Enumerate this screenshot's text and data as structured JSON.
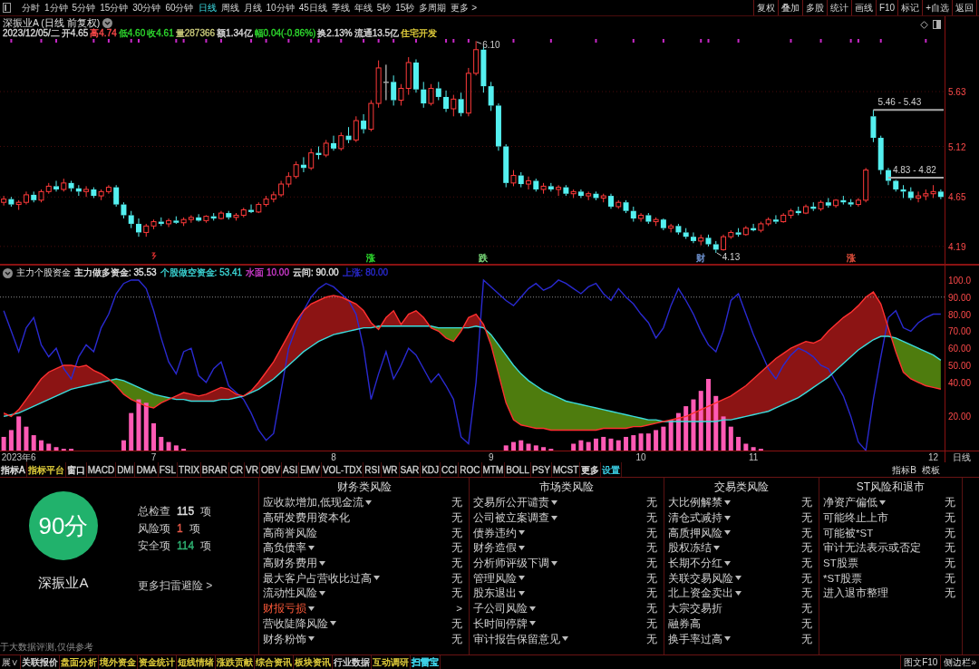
{
  "toolbar": {
    "periods": [
      {
        "label": "分时",
        "selected": false
      },
      {
        "label": "1分钟",
        "selected": false
      },
      {
        "label": "5分钟",
        "selected": false
      },
      {
        "label": "15分钟",
        "selected": false
      },
      {
        "label": "30分钟",
        "selected": false
      },
      {
        "label": "60分钟",
        "selected": false
      },
      {
        "label": "日线",
        "selected": true
      },
      {
        "label": "周线",
        "selected": false
      },
      {
        "label": "月线",
        "selected": false
      },
      {
        "label": "10分钟",
        "selected": false
      },
      {
        "label": "45日线",
        "selected": false
      },
      {
        "label": "季线",
        "selected": false
      },
      {
        "label": "年线",
        "selected": false
      },
      {
        "label": "5秒",
        "selected": false
      },
      {
        "label": "15秒",
        "selected": false
      },
      {
        "label": "多周期",
        "selected": false
      },
      {
        "label": "更多 >",
        "selected": false
      }
    ],
    "actions": [
      "复权",
      "叠加",
      "多股",
      "统计",
      "画线",
      "F10",
      "标记",
      "+自选",
      "返回"
    ]
  },
  "price_chart": {
    "title": "深振业A (日线 前复权)",
    "quote": [
      {
        "text": "2023/12/05/二",
        "color": "#dcdcdc"
      },
      {
        "text": "开4.65",
        "color": "#dcdcdc"
      },
      {
        "text": "高4.74",
        "color": "#ff4a4a"
      },
      {
        "text": "低4.60",
        "color": "#2ed82e"
      },
      {
        "text": "收4.61",
        "color": "#2ed82e"
      },
      {
        "text": "量287366",
        "color": "#c8c87a"
      },
      {
        "text": "额1.34亿",
        "color": "#dcdcdc"
      },
      {
        "text": "幅0.04(-0.86%)",
        "color": "#2ed82e"
      },
      {
        "text": "换2.13%",
        "color": "#dcdcdc"
      },
      {
        "text": "流通13.5亿",
        "color": "#dcdcdc"
      },
      {
        "text": "住宅开发",
        "color": "#e6d23c"
      }
    ],
    "event_tags": [
      {
        "color": "#2ed82e"
      },
      {
        "color": "#7ad87a"
      },
      {
        "color": "#6a8cc8"
      },
      {
        "color": "#e0503c"
      }
    ],
    "chart_data": {
      "type": "candlestick",
      "ylim": [
        4.02,
        6.33
      ],
      "yticks": [
        5.63,
        5.12,
        4.65,
        4.19
      ],
      "grid": true,
      "categories": [
        null,
        null,
        null,
        null,
        null,
        null,
        null,
        null,
        null,
        null,
        null,
        null,
        null,
        null,
        null,
        null,
        null,
        null,
        null,
        null,
        null,
        null,
        null,
        null,
        null,
        null,
        null,
        null,
        null,
        null,
        null,
        null,
        null,
        null,
        null,
        null,
        null,
        null,
        null,
        null,
        null,
        null,
        null,
        null,
        null,
        null,
        null,
        null,
        null,
        "涨",
        null,
        null,
        null,
        null,
        null,
        null,
        null,
        null,
        null,
        null,
        null,
        null,
        null,
        null,
        "跌",
        null,
        null,
        null,
        null,
        null,
        null,
        null,
        null,
        null,
        null,
        null,
        null,
        null,
        null,
        null,
        null,
        null,
        null,
        null,
        null,
        null,
        null,
        null,
        null,
        null,
        null,
        null,
        null,
        "财",
        null,
        null,
        null,
        null,
        null,
        null,
        null,
        null,
        null,
        null,
        null,
        null,
        null,
        null,
        null,
        null,
        null,
        null,
        null,
        "涨",
        null,
        null,
        null,
        null,
        null,
        null,
        null,
        null,
        null,
        null,
        null,
        null
      ],
      "ohlc": [
        [
          4.6,
          4.66,
          4.57,
          4.63
        ],
        [
          4.63,
          4.65,
          4.56,
          4.58
        ],
        [
          4.58,
          4.62,
          4.53,
          4.6
        ],
        [
          4.6,
          4.7,
          4.58,
          4.67
        ],
        [
          4.67,
          4.7,
          4.6,
          4.62
        ],
        [
          4.62,
          4.72,
          4.6,
          4.7
        ],
        [
          4.7,
          4.78,
          4.68,
          4.75
        ],
        [
          4.75,
          4.8,
          4.7,
          4.72
        ],
        [
          4.72,
          4.82,
          4.7,
          4.78
        ],
        [
          4.78,
          4.8,
          4.7,
          4.73
        ],
        [
          4.73,
          4.76,
          4.66,
          4.7
        ],
        [
          4.7,
          4.75,
          4.65,
          4.72
        ],
        [
          4.72,
          4.74,
          4.64,
          4.66
        ],
        [
          4.66,
          4.72,
          4.62,
          4.7
        ],
        [
          4.7,
          4.76,
          4.68,
          4.74
        ],
        [
          4.74,
          4.76,
          4.56,
          4.58
        ],
        [
          4.58,
          4.6,
          4.45,
          4.48
        ],
        [
          4.48,
          4.52,
          4.36,
          4.4
        ],
        [
          4.4,
          4.45,
          4.28,
          4.32
        ],
        [
          4.32,
          4.4,
          4.28,
          4.38
        ],
        [
          4.38,
          4.44,
          4.35,
          4.42
        ],
        [
          4.42,
          4.46,
          4.38,
          4.4
        ],
        [
          4.4,
          4.45,
          4.37,
          4.43
        ],
        [
          4.43,
          4.47,
          4.4,
          4.41
        ],
        [
          4.41,
          4.46,
          4.38,
          4.44
        ],
        [
          4.44,
          4.48,
          4.41,
          4.46
        ],
        [
          4.46,
          4.49,
          4.42,
          4.43
        ],
        [
          4.43,
          4.48,
          4.41,
          4.47
        ],
        [
          4.47,
          4.5,
          4.43,
          4.45
        ],
        [
          4.45,
          4.52,
          4.44,
          4.5
        ],
        [
          4.5,
          4.52,
          4.44,
          4.46
        ],
        [
          4.46,
          4.5,
          4.43,
          4.48
        ],
        [
          4.48,
          4.55,
          4.46,
          4.53
        ],
        [
          4.53,
          4.58,
          4.5,
          4.51
        ],
        [
          4.51,
          4.6,
          4.5,
          4.58
        ],
        [
          4.58,
          4.66,
          4.56,
          4.63
        ],
        [
          4.63,
          4.7,
          4.6,
          4.67
        ],
        [
          4.67,
          4.8,
          4.65,
          4.77
        ],
        [
          4.77,
          4.88,
          4.74,
          4.84
        ],
        [
          4.84,
          4.98,
          4.82,
          4.95
        ],
        [
          4.95,
          5.02,
          4.88,
          4.92
        ],
        [
          4.92,
          5.1,
          4.9,
          5.06
        ],
        [
          5.06,
          5.12,
          5.0,
          5.04
        ],
        [
          5.04,
          5.18,
          5.02,
          5.15
        ],
        [
          5.15,
          5.22,
          5.08,
          5.1
        ],
        [
          5.1,
          5.25,
          5.08,
          5.22
        ],
        [
          5.22,
          5.3,
          5.15,
          5.18
        ],
        [
          5.18,
          5.4,
          5.16,
          5.36
        ],
        [
          5.36,
          5.42,
          5.24,
          5.28
        ],
        [
          5.28,
          5.55,
          5.26,
          5.52
        ],
        [
          5.52,
          5.92,
          5.48,
          5.85
        ],
        [
          5.72,
          5.88,
          5.55,
          5.72
        ],
        [
          5.72,
          5.78,
          5.5,
          5.55
        ],
        [
          5.55,
          5.7,
          5.5,
          5.66
        ],
        [
          5.66,
          5.95,
          5.6,
          5.9
        ],
        [
          5.9,
          5.93,
          5.62,
          5.65
        ],
        [
          5.65,
          5.72,
          5.48,
          5.52
        ],
        [
          5.52,
          5.7,
          5.5,
          5.66
        ],
        [
          5.66,
          5.72,
          5.55,
          5.58
        ],
        [
          5.58,
          5.64,
          5.44,
          5.47
        ],
        [
          5.47,
          5.6,
          5.4,
          5.56
        ],
        [
          5.56,
          5.62,
          5.4,
          5.43
        ],
        [
          5.43,
          5.85,
          5.4,
          5.8
        ],
        [
          5.8,
          6.1,
          5.78,
          6.02
        ],
        [
          6.02,
          6.05,
          5.62,
          5.68
        ],
        [
          5.68,
          5.72,
          5.45,
          5.5
        ],
        [
          5.5,
          5.52,
          5.08,
          5.12
        ],
        [
          5.12,
          5.14,
          4.74,
          4.78
        ],
        [
          4.78,
          4.9,
          4.75,
          4.85
        ],
        [
          4.85,
          4.88,
          4.74,
          4.77
        ],
        [
          4.77,
          4.84,
          4.72,
          4.8
        ],
        [
          4.8,
          4.82,
          4.7,
          4.72
        ],
        [
          4.72,
          4.78,
          4.68,
          4.75
        ],
        [
          4.75,
          4.78,
          4.7,
          4.72
        ],
        [
          4.72,
          4.76,
          4.66,
          4.74
        ],
        [
          4.74,
          4.76,
          4.66,
          4.68
        ],
        [
          4.68,
          4.72,
          4.64,
          4.7
        ],
        [
          4.7,
          4.72,
          4.64,
          4.66
        ],
        [
          4.66,
          4.7,
          4.62,
          4.68
        ],
        [
          4.68,
          4.7,
          4.62,
          4.64
        ],
        [
          4.64,
          4.68,
          4.6,
          4.66
        ],
        [
          4.66,
          4.68,
          4.54,
          4.56
        ],
        [
          4.56,
          4.62,
          4.54,
          4.6
        ],
        [
          4.6,
          4.62,
          4.5,
          4.52
        ],
        [
          4.52,
          4.56,
          4.42,
          4.45
        ],
        [
          4.45,
          4.5,
          4.42,
          4.48
        ],
        [
          4.48,
          4.5,
          4.4,
          4.42
        ],
        [
          4.42,
          4.46,
          4.38,
          4.44
        ],
        [
          4.44,
          4.45,
          4.34,
          4.36
        ],
        [
          4.36,
          4.4,
          4.32,
          4.38
        ],
        [
          4.38,
          4.4,
          4.3,
          4.32
        ],
        [
          4.32,
          4.36,
          4.26,
          4.28
        ],
        [
          4.28,
          4.32,
          4.22,
          4.24
        ],
        [
          4.24,
          4.3,
          4.2,
          4.27
        ],
        [
          4.27,
          4.3,
          4.19,
          4.21
        ],
        [
          4.21,
          4.24,
          4.13,
          4.16
        ],
        [
          4.16,
          4.3,
          4.15,
          4.28
        ],
        [
          4.28,
          4.34,
          4.26,
          4.32
        ],
        [
          4.32,
          4.36,
          4.28,
          4.3
        ],
        [
          4.3,
          4.38,
          4.29,
          4.36
        ],
        [
          4.36,
          4.4,
          4.33,
          4.34
        ],
        [
          4.34,
          4.42,
          4.32,
          4.4
        ],
        [
          4.4,
          4.46,
          4.38,
          4.44
        ],
        [
          4.44,
          4.48,
          4.4,
          4.42
        ],
        [
          4.42,
          4.5,
          4.41,
          4.48
        ],
        [
          4.48,
          4.54,
          4.45,
          4.52
        ],
        [
          4.52,
          4.56,
          4.48,
          4.5
        ],
        [
          4.5,
          4.58,
          4.49,
          4.56
        ],
        [
          4.56,
          4.6,
          4.52,
          4.54
        ],
        [
          4.54,
          4.62,
          4.52,
          4.6
        ],
        [
          4.6,
          4.64,
          4.55,
          4.57
        ],
        [
          4.57,
          4.63,
          4.55,
          4.62
        ],
        [
          4.62,
          4.66,
          4.58,
          4.6
        ],
        [
          4.6,
          4.63,
          4.56,
          4.58
        ],
        [
          4.58,
          4.64,
          4.56,
          4.62
        ],
        [
          4.62,
          4.92,
          4.6,
          4.9
        ],
        [
          5.4,
          5.46,
          5.16,
          5.2
        ],
        [
          5.2,
          5.22,
          4.86,
          4.9
        ],
        [
          4.9,
          4.92,
          4.76,
          4.8
        ],
        [
          4.8,
          4.81,
          4.7,
          4.72
        ],
        [
          4.72,
          4.76,
          4.64,
          4.7
        ],
        [
          4.7,
          4.74,
          4.62,
          4.64
        ],
        [
          4.64,
          4.7,
          4.6,
          4.66
        ],
        [
          4.66,
          4.72,
          4.62,
          4.68
        ],
        [
          4.68,
          4.76,
          4.64,
          4.7
        ],
        [
          4.7,
          4.72,
          4.63,
          4.65
        ]
      ],
      "annotations": [
        "6.10",
        "4.13"
      ],
      "ref_lines": [
        {
          "axis": "y",
          "value": 5.46,
          "label": "5.46 - 5.43",
          "color": "#a8a8a8",
          "line_style": "solid"
        },
        {
          "axis": "y",
          "value": 4.83,
          "label": "4.83 - 4.82",
          "color": "#a8a8a8",
          "line_style": "solid"
        }
      ]
    }
  },
  "indicator": {
    "name": "主力个股资金",
    "legend": [
      {
        "label": "主力做多资金: 35.53",
        "color": "#e6e6e6"
      },
      {
        "label": "个股做空资金: 53.41",
        "color": "#3cd8d8"
      },
      {
        "label": "水面 10.00",
        "color": "#d23cd2"
      },
      {
        "label": "云间: 90.00",
        "color": "#e6e6e6"
      },
      {
        "label": "上涨: 80.00",
        "color": "#2a2ad0"
      }
    ],
    "period": "日线",
    "chart_data": {
      "type": "line",
      "ylim": [
        0,
        109
      ],
      "yticks": [
        {
          "value": 100,
          "label": "100.0"
        },
        {
          "value": 90,
          "label": "90.00"
        },
        {
          "value": 80,
          "label": "80.00"
        },
        {
          "value": 70,
          "label": "70.00"
        },
        {
          "value": 60,
          "label": "60.00"
        },
        {
          "value": 50,
          "label": "50.00"
        },
        {
          "value": 40,
          "label": "40.00"
        },
        {
          "value": 20,
          "label": "20.00"
        }
      ],
      "categories": [
        null,
        null,
        "2023年6",
        null,
        null,
        null,
        null,
        null,
        null,
        null,
        null,
        null,
        null,
        null,
        null,
        null,
        null,
        null,
        null,
        null,
        "7",
        null,
        null,
        null,
        null,
        null,
        null,
        null,
        null,
        null,
        null,
        null,
        null,
        null,
        null,
        null,
        null,
        null,
        null,
        null,
        null,
        null,
        null,
        null,
        "8",
        null,
        null,
        null,
        null,
        null,
        null,
        null,
        null,
        null,
        null,
        null,
        null,
        null,
        null,
        null,
        null,
        null,
        null,
        null,
        null,
        "9",
        null,
        null,
        null,
        null,
        null,
        null,
        null,
        null,
        null,
        null,
        null,
        null,
        null,
        null,
        null,
        null,
        null,
        null,
        null,
        "10",
        null,
        null,
        null,
        null,
        null,
        null,
        null,
        null,
        null,
        null,
        null,
        null,
        null,
        null,
        "11",
        null,
        null,
        null,
        null,
        null,
        null,
        null,
        null,
        null,
        null,
        null,
        null,
        null,
        null,
        null,
        null,
        null,
        null,
        null,
        null,
        null,
        null,
        null,
        "12",
        null
      ],
      "ref_lines": [
        {
          "axis": "y",
          "value": 90,
          "color": "#8c8c8c",
          "line_style": "dotted"
        }
      ],
      "series": [
        {
          "type": "line",
          "color": "#ff3030",
          "values": [
            22,
            20,
            24,
            30,
            36,
            42,
            46,
            48,
            50,
            50,
            49,
            50,
            47,
            45,
            42,
            38,
            33,
            30,
            28,
            26,
            25,
            28,
            30,
            32,
            34,
            33,
            32,
            33,
            35,
            37,
            36,
            33,
            32,
            35,
            40,
            46,
            52,
            60,
            68,
            76,
            82,
            86,
            88,
            90,
            91,
            90,
            88,
            86,
            82,
            75,
            71,
            78,
            82,
            74,
            80,
            82,
            78,
            72,
            70,
            66,
            64,
            70,
            78,
            80,
            74,
            62,
            45,
            28,
            18,
            15,
            14,
            13,
            13,
            12,
            12,
            12,
            12,
            12,
            12,
            12,
            13,
            13,
            13,
            13,
            14,
            14,
            15,
            16,
            17,
            18,
            19,
            20,
            22,
            24,
            26,
            28,
            30,
            32,
            35,
            38,
            42,
            46,
            50,
            54,
            57,
            60,
            62,
            64,
            63,
            65,
            70,
            74,
            78,
            81,
            85,
            90,
            93,
            86,
            72,
            58,
            46,
            42,
            40,
            38,
            37,
            36
          ]
        },
        {
          "type": "line",
          "color": "#3cdcdc",
          "values": [
            20,
            21,
            22,
            24,
            26,
            28,
            30,
            32,
            34,
            36,
            37,
            38,
            39,
            40,
            41,
            42,
            41,
            39,
            37,
            35,
            33,
            32,
            31,
            30,
            30,
            29,
            29,
            29,
            29,
            30,
            30,
            31,
            32,
            34,
            36,
            39,
            42,
            46,
            50,
            54,
            58,
            61,
            64,
            66,
            68,
            69,
            70,
            71,
            72,
            72,
            73,
            73,
            73,
            73,
            73,
            73,
            73,
            73,
            72,
            72,
            72,
            72,
            72,
            73,
            72,
            68,
            62,
            56,
            50,
            45,
            41,
            38,
            35,
            33,
            31,
            29,
            28,
            27,
            26,
            25,
            24,
            23,
            22,
            21,
            20,
            19,
            18,
            18,
            17,
            17,
            17,
            17,
            17,
            17,
            17,
            17,
            18,
            18,
            19,
            20,
            21,
            22,
            23,
            25,
            27,
            29,
            31,
            34,
            37,
            40,
            43,
            47,
            51,
            55,
            59,
            62,
            65,
            67,
            67,
            66,
            64,
            62,
            60,
            58,
            56,
            53
          ]
        },
        {
          "type": "line",
          "color": "#2a2ad0",
          "values": [
            82,
            70,
            58,
            72,
            78,
            62,
            55,
            60,
            48,
            42,
            55,
            62,
            58,
            72,
            80,
            92,
            98,
            100,
            100,
            95,
            82,
            66,
            52,
            45,
            58,
            60,
            44,
            40,
            48,
            52,
            38,
            34,
            30,
            22,
            12,
            6,
            10,
            35,
            60,
            72,
            82,
            90,
            95,
            98,
            96,
            92,
            88,
            80,
            60,
            30,
            45,
            58,
            42,
            50,
            60,
            56,
            48,
            40,
            45,
            38,
            30,
            8,
            4,
            40,
            100,
            96,
            92,
            88,
            85,
            90,
            95,
            98,
            94,
            96,
            100,
            98,
            95,
            92,
            96,
            98,
            92,
            88,
            95,
            90,
            86,
            80,
            75,
            66,
            72,
            85,
            95,
            88,
            80,
            70,
            62,
            58,
            70,
            88,
            92,
            80,
            68,
            58,
            48,
            42,
            50,
            56,
            60,
            58,
            55,
            50,
            48,
            40,
            32,
            20,
            5,
            0,
            30,
            55,
            78,
            82,
            72,
            70,
            75,
            78,
            80,
            80
          ]
        },
        {
          "type": "bar",
          "color": "#ff5ab4",
          "values": [
            8,
            12,
            20,
            14,
            9,
            6,
            4,
            2,
            1,
            1,
            null,
            null,
            null,
            null,
            null,
            null,
            6,
            22,
            30,
            28,
            16,
            8,
            5,
            3,
            1,
            null,
            null,
            null,
            null,
            null,
            null,
            null,
            null,
            null,
            null,
            null,
            null,
            null,
            null,
            null,
            null,
            null,
            null,
            null,
            null,
            null,
            null,
            null,
            null,
            null,
            null,
            null,
            null,
            null,
            null,
            null,
            null,
            null,
            null,
            null,
            null,
            null,
            null,
            null,
            null,
            null,
            null,
            3,
            5,
            6,
            4,
            3,
            2,
            1,
            null,
            null,
            4,
            6,
            5,
            7,
            8,
            7,
            6,
            8,
            9,
            10,
            10,
            12,
            14,
            18,
            22,
            26,
            30,
            35,
            42,
            32,
            20,
            14,
            8,
            4,
            2,
            1,
            null,
            null,
            null,
            null,
            null,
            null,
            null,
            null,
            null,
            null,
            null,
            null,
            null,
            null,
            null,
            null,
            null,
            null,
            null,
            null,
            null,
            null,
            null,
            null
          ]
        }
      ]
    }
  },
  "indicator_tabs": {
    "items": [
      {
        "label": "指标A",
        "color": "#e6e6e6"
      },
      {
        "label": "指标平台",
        "color": "#e6d23c"
      },
      {
        "label": "窗口",
        "color": "#e6e6e6"
      },
      {
        "label": "MACD",
        "color": "#cfcfcf"
      },
      {
        "label": "DMI",
        "color": "#cfcfcf"
      },
      {
        "label": "DMA",
        "color": "#cfcfcf"
      },
      {
        "label": "FSL",
        "color": "#cfcfcf"
      },
      {
        "label": "TRIX",
        "color": "#cfcfcf"
      },
      {
        "label": "BRAR",
        "color": "#cfcfcf"
      },
      {
        "label": "CR",
        "color": "#cfcfcf"
      },
      {
        "label": "VR",
        "color": "#cfcfcf"
      },
      {
        "label": "OBV",
        "color": "#cfcfcf"
      },
      {
        "label": "ASI",
        "color": "#cfcfcf"
      },
      {
        "label": "EMV",
        "color": "#cfcfcf"
      },
      {
        "label": "VOL-TDX",
        "color": "#cfcfcf"
      },
      {
        "label": "RSI",
        "color": "#cfcfcf"
      },
      {
        "label": "WR",
        "color": "#cfcfcf"
      },
      {
        "label": "SAR",
        "color": "#cfcfcf"
      },
      {
        "label": "KDJ",
        "color": "#cfcfcf"
      },
      {
        "label": "CCI",
        "color": "#cfcfcf"
      },
      {
        "label": "ROC",
        "color": "#cfcfcf"
      },
      {
        "label": "MTM",
        "color": "#cfcfcf"
      },
      {
        "label": "BOLL",
        "color": "#cfcfcf"
      },
      {
        "label": "PSY",
        "color": "#cfcfcf"
      },
      {
        "label": "MCST",
        "color": "#cfcfcf"
      },
      {
        "label": "更多",
        "color": "#e6e6e6"
      },
      {
        "label": "设置",
        "color": "#3cd0e6"
      }
    ],
    "right_items": [
      "指标B",
      "模板"
    ]
  },
  "risk_scan": {
    "score": "90分",
    "stock": "深振业A",
    "stats": [
      {
        "label": "总检查",
        "count": "115",
        "unit": "项",
        "color": "#e0e0e0"
      },
      {
        "label": "风险项",
        "count": "1",
        "unit": "项",
        "color": "#e85a4a"
      },
      {
        "label": "安全项",
        "count": "114",
        "unit": "项",
        "color": "#2fb474"
      }
    ],
    "more_link": "更多扫雷避险 >",
    "note": "于大数据评测,仅供参考",
    "columns": [
      {
        "title": "财务类风险",
        "rows": [
          {
            "name": "应收款增加,低现金流",
            "value": "无",
            "expandable": true,
            "flagged": false
          },
          {
            "name": "高研发费用资本化",
            "value": "无",
            "expandable": false,
            "flagged": false
          },
          {
            "name": "高商誉风险",
            "value": "无",
            "expandable": false,
            "flagged": false
          },
          {
            "name": "高负债率",
            "value": "无",
            "expandable": true,
            "flagged": false
          },
          {
            "name": "高财务费用",
            "value": "无",
            "expandable": true,
            "flagged": false
          },
          {
            "name": "最大客户占营收比过高",
            "value": "无",
            "expandable": true,
            "flagged": false
          },
          {
            "name": "流动性风险",
            "value": "无",
            "expandable": true,
            "flagged": false
          },
          {
            "name": "财报亏损",
            "value": ">",
            "expandable": true,
            "flagged": true
          },
          {
            "name": "营收陡降风险",
            "value": "无",
            "expandable": true,
            "flagged": false
          },
          {
            "name": "财务粉饰",
            "value": "无",
            "expandable": true,
            "flagged": false
          }
        ]
      },
      {
        "title": "市场类风险",
        "rows": [
          {
            "name": "交易所公开谴责",
            "value": "无",
            "expandable": true,
            "flagged": false
          },
          {
            "name": "公司被立案调查",
            "value": "无",
            "expandable": true,
            "flagged": false
          },
          {
            "name": "债券违约",
            "value": "无",
            "expandable": true,
            "flagged": false
          },
          {
            "name": "财务造假",
            "value": "无",
            "expandable": true,
            "flagged": false
          },
          {
            "name": "分析师评级下调",
            "value": "无",
            "expandable": true,
            "flagged": false
          },
          {
            "name": "管理风险",
            "value": "无",
            "expandable": true,
            "flagged": false
          },
          {
            "name": "股东退出",
            "value": "无",
            "expandable": true,
            "flagged": false
          },
          {
            "name": "子公司风险",
            "value": "无",
            "expandable": true,
            "flagged": false
          },
          {
            "name": "长时间停牌",
            "value": "无",
            "expandable": true,
            "flagged": false
          },
          {
            "name": "审计报告保留意见",
            "value": "无",
            "expandable": true,
            "flagged": false
          }
        ]
      },
      {
        "title": "交易类风险",
        "rows": [
          {
            "name": "大比例解禁",
            "value": "无",
            "expandable": true,
            "flagged": false
          },
          {
            "name": "清仓式减持",
            "value": "无",
            "expandable": true,
            "flagged": false
          },
          {
            "name": "高质押风险",
            "value": "无",
            "expandable": true,
            "flagged": false
          },
          {
            "name": "股权冻结",
            "value": "无",
            "expandable": true,
            "flagged": false
          },
          {
            "name": "长期不分红",
            "value": "无",
            "expandable": true,
            "flagged": false
          },
          {
            "name": "关联交易风险",
            "value": "无",
            "expandable": true,
            "flagged": false
          },
          {
            "name": "北上资金卖出",
            "value": "无",
            "expandable": true,
            "flagged": false
          },
          {
            "name": "大宗交易折",
            "value": "无",
            "expandable": false,
            "flagged": false
          },
          {
            "name": "融券高",
            "value": "无",
            "expandable": false,
            "flagged": false
          },
          {
            "name": "换手率过高",
            "value": "无",
            "expandable": true,
            "flagged": false
          }
        ]
      },
      {
        "title": "ST风险和退市",
        "rows": [
          {
            "name": "净资产偏低",
            "value": "无",
            "expandable": true,
            "flagged": false
          },
          {
            "name": "可能终止上市",
            "value": "无",
            "expandable": false,
            "flagged": false
          },
          {
            "name": "可能被*ST",
            "value": "无",
            "expandable": false,
            "flagged": false
          },
          {
            "name": "审计无法表示或否定",
            "value": "无",
            "expandable": false,
            "flagged": false
          },
          {
            "name": "ST股票",
            "value": "无",
            "expandable": false,
            "flagged": false
          },
          {
            "name": "*ST股票",
            "value": "无",
            "expandable": false,
            "flagged": false
          },
          {
            "name": "进入退市整理",
            "value": "无",
            "expandable": false,
            "flagged": false
          }
        ]
      }
    ]
  },
  "bottom_tabs": {
    "expand": "展∨",
    "items": [
      {
        "label": "关联报价",
        "selected": false,
        "color": "#dcdcdc"
      },
      {
        "label": "盘面分析",
        "selected": false,
        "color": "#e6d23c"
      },
      {
        "label": "境外资金",
        "selected": false,
        "color": "#e6d23c"
      },
      {
        "label": "资金统计",
        "selected": false,
        "color": "#e6d23c"
      },
      {
        "label": "短线情绪",
        "selected": false,
        "color": "#e6d23c"
      },
      {
        "label": "涨跌贡献",
        "selected": false,
        "color": "#e6d23c"
      },
      {
        "label": "综合资讯",
        "selected": false,
        "color": "#e6d23c"
      },
      {
        "label": "板块资讯",
        "selected": false,
        "color": "#e6d23c"
      },
      {
        "label": "行业数据",
        "selected": false,
        "color": "#dcdcdc"
      },
      {
        "label": "互动调研",
        "selected": false,
        "color": "#e6d23c"
      },
      {
        "label": "扫雷宝",
        "selected": true,
        "color": "#3cd0e6"
      }
    ],
    "right_items": [
      "图文F10",
      "侧边栏»"
    ]
  }
}
